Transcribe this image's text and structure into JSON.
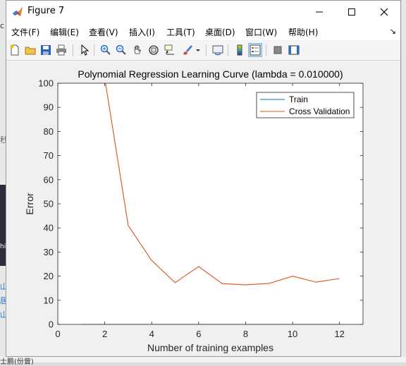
{
  "window": {
    "title": "Figure 7"
  },
  "menu": {
    "items": [
      "文件(F)",
      "编辑(E)",
      "查看(V)",
      "插入(I)",
      "工具(T)",
      "桌面(D)",
      "窗口(W)",
      "帮助(H)"
    ]
  },
  "toolbar": {
    "icons": [
      "new-figure-icon",
      "open-icon",
      "save-icon",
      "print-icon",
      "pointer-icon",
      "zoom-in-icon",
      "zoom-out-icon",
      "pan-icon",
      "rotate-3d-icon",
      "data-cursor-icon",
      "brush-icon",
      "link-plot-icon",
      "insert-colorbar-icon",
      "insert-legend-icon",
      "hide-plot-tools-icon",
      "show-plot-tools-icon"
    ]
  },
  "background": {
    "left_fragments": [
      "c",
      "秒",
      "hi",
      "山",
      "居",
      "山"
    ],
    "bottom_fragment": "士鹏(份曾)"
  },
  "chart_data": {
    "type": "line",
    "title": "Polynomial Regression Learning Curve (lambda = 0.010000)",
    "xlabel": "Number of training examples",
    "ylabel": "Error",
    "xlim": [
      0,
      13
    ],
    "ylim": [
      0,
      100
    ],
    "xticks": [
      0,
      2,
      4,
      6,
      8,
      10,
      12
    ],
    "yticks": [
      0,
      10,
      20,
      30,
      40,
      50,
      60,
      70,
      80,
      90,
      100
    ],
    "legend_position": "top-right",
    "series": [
      {
        "name": "Train",
        "color": "#0072bd",
        "x": [
          1,
          2,
          3,
          4,
          5,
          6,
          7,
          8,
          9,
          10,
          11,
          12
        ],
        "y": [
          0,
          0,
          0,
          0,
          0,
          0,
          0,
          0,
          0,
          0,
          0,
          0
        ]
      },
      {
        "name": "Cross Validation",
        "color": "#d95319",
        "x": [
          2,
          3,
          4,
          5,
          6,
          7,
          8,
          9,
          10,
          11,
          12
        ],
        "y": [
          102,
          41,
          26.5,
          17.3,
          24,
          16.9,
          16.4,
          17,
          20,
          17.5,
          19
        ]
      }
    ]
  }
}
